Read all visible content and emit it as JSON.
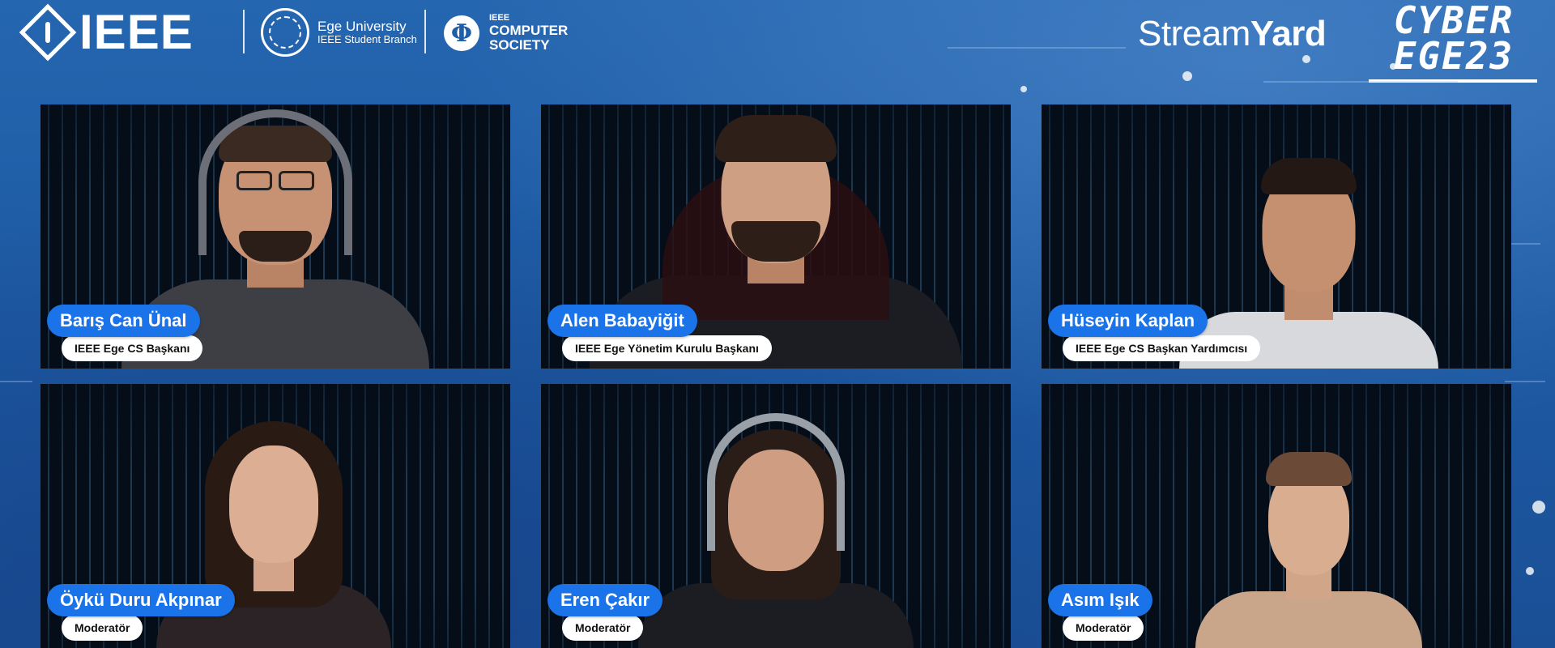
{
  "header": {
    "ieee_logo": "IEEE",
    "ege_university": {
      "line1": "Ege University",
      "line2": "IEEE Student Branch"
    },
    "computer_society": {
      "line1": "IEEE",
      "line2": "COMPUTER",
      "line3": "SOCIETY"
    },
    "streamyard": {
      "part1": "Stream",
      "part2": "Yard"
    },
    "event_logo": {
      "line1": "CYBER",
      "line2": "EGE23"
    }
  },
  "participants": [
    {
      "name": "Barış Can Ünal",
      "title": "IEEE Ege CS Başkanı"
    },
    {
      "name": "Alen Babayiğit",
      "title": "IEEE Ege Yönetim Kurulu Başkanı"
    },
    {
      "name": "Hüseyin Kaplan",
      "title": "IEEE Ege CS Başkan Yardımcısı"
    },
    {
      "name": "Öykü Duru Akpınar",
      "title": "Moderatör"
    },
    {
      "name": "Eren Çakır",
      "title": "Moderatör"
    },
    {
      "name": "Asım Işık",
      "title": "Moderatör"
    }
  ],
  "colors": {
    "background": "#1f5fa8",
    "name_pill": "#1a73e8",
    "title_pill": "#ffffff"
  }
}
